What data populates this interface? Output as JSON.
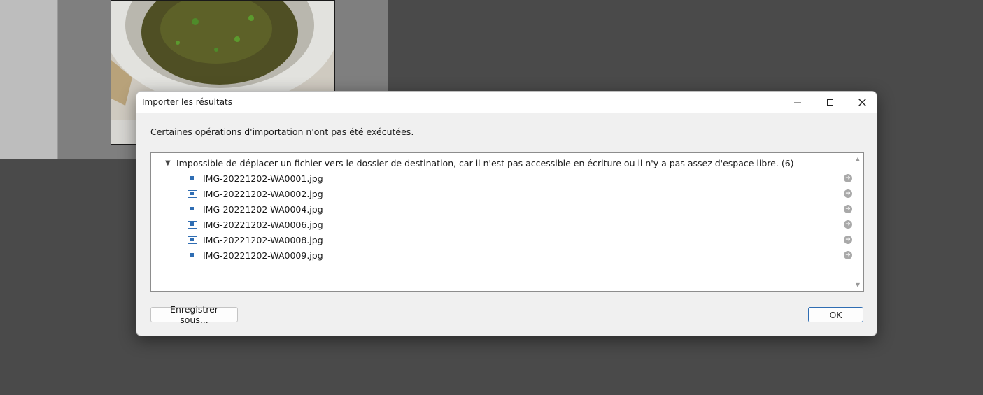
{
  "dialog": {
    "title": "Importer les résultats",
    "message": "Certaines opérations d'importation n'ont pas été exécutées.",
    "group": {
      "toggle_icon": "▼",
      "label": "Impossible de déplacer un fichier vers le dossier de destination, car il n'est pas accessible en écriture ou il n'y a pas assez d'espace libre. (6)",
      "files": [
        "IMG-20221202-WA0001.jpg",
        "IMG-20221202-WA0002.jpg",
        "IMG-20221202-WA0004.jpg",
        "IMG-20221202-WA0006.jpg",
        "IMG-20221202-WA0008.jpg",
        "IMG-20221202-WA0009.jpg"
      ]
    },
    "buttons": {
      "save_as": "Enregistrer sous...",
      "ok": "OK"
    },
    "window_controls": {
      "minimize": "—",
      "close": "✕"
    }
  },
  "icons": {
    "file": "image-file-icon",
    "go": "arrow-right-circle-icon",
    "scroll_up": "▲",
    "scroll_down": "▼"
  }
}
